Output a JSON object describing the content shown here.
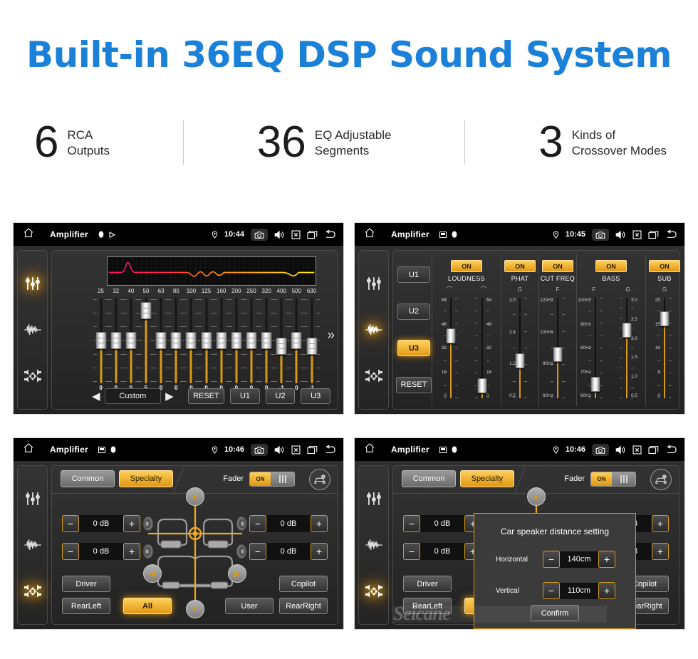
{
  "headline": "Built-in 36EQ DSP Sound System",
  "accent_blue": "#1a80d8",
  "accent_amber": "#e09612",
  "stats": [
    {
      "number": "6",
      "text": "RCA\nOutputs"
    },
    {
      "number": "36",
      "text": "EQ Adjustable\nSegments"
    },
    {
      "number": "3",
      "text": "Kinds of\nCrossover Modes"
    }
  ],
  "watermark": "Seicane",
  "panels": {
    "eq": {
      "statusbar": {
        "title": "Amplifier",
        "time": "10:44"
      },
      "frequencies": [
        "25",
        "32",
        "40",
        "50",
        "63",
        "80",
        "100",
        "125",
        "160",
        "200",
        "250",
        "320",
        "400",
        "500",
        "630"
      ],
      "values": [
        "0",
        "0",
        "0",
        "5",
        "0",
        "0",
        "0",
        "0",
        "0",
        "0",
        "0",
        "0",
        "-1",
        "0",
        "-1"
      ],
      "preset": "Custom",
      "reset_label": "RESET",
      "u1": "U1",
      "u2": "U2",
      "u3": "U3",
      "next_label": "»"
    },
    "crossover": {
      "statusbar": {
        "title": "Amplifier",
        "time": "10:45"
      },
      "user_buttons": [
        "U1",
        "U2",
        "U3"
      ],
      "active_user": "U3",
      "reset_label": "RESET",
      "sections": [
        {
          "name": "LOUDNESS",
          "state": "ON",
          "glyphs": [
            "⌒",
            "⌒"
          ],
          "scale_left": [
            "64",
            "48",
            "32",
            "16",
            "0"
          ],
          "scale_right": [
            "64",
            "48",
            "32",
            "16",
            "0"
          ]
        },
        {
          "name": "PHAT",
          "state": "ON",
          "glyphs": [
            "G"
          ],
          "scale_left": [
            "3.0",
            "2.1",
            "1.3",
            "0.5"
          ]
        },
        {
          "name": "CUT FREQ",
          "state": "ON",
          "glyphs": [
            "F"
          ],
          "scale_left": [
            "120Hz",
            "100Hz",
            "80Hz",
            "60Hz"
          ]
        },
        {
          "name": "BASS",
          "state": "ON",
          "glyphs": [
            "F",
            "G"
          ],
          "scale_left": [
            "100Hz",
            "90Hz",
            "80Hz",
            "70Hz",
            "60Hz"
          ],
          "scale_right": [
            "3.0",
            "2.5",
            "2.0",
            "1.5",
            "1.0",
            "0.5"
          ]
        },
        {
          "name": "SUB",
          "state": "ON",
          "glyphs": [
            "G"
          ],
          "scale_left": [
            "20",
            "15",
            "10",
            "5",
            "0"
          ]
        }
      ]
    },
    "fader": {
      "statusbar": {
        "title": "Amplifier",
        "time": "10:46"
      },
      "tab_common": "Common",
      "tab_specialty": "Specialty",
      "fader_label": "Fader",
      "fader_state": "ON",
      "channels": [
        {
          "position": "front-left",
          "value": "0 dB"
        },
        {
          "position": "rear-left",
          "value": "0 dB"
        },
        {
          "position": "front-right",
          "value": "0 dB"
        },
        {
          "position": "rear-right",
          "value": "0 dB"
        }
      ],
      "minus": "−",
      "plus": "+",
      "buttons": {
        "driver": "Driver",
        "rearleft": "RearLeft",
        "all": "All",
        "user": "User",
        "copilot": "Copilot",
        "rearright": "RearRight"
      },
      "active_button": "All"
    },
    "distance": {
      "statusbar": {
        "title": "Amplifier",
        "time": "10:46"
      },
      "dialog": {
        "title": "Car speaker distance setting",
        "horizontal_label": "Horizontal",
        "horizontal_value": "140cm",
        "vertical_label": "Vertical",
        "vertical_value": "110cm",
        "confirm_label": "Confirm",
        "minus": "−",
        "plus": "+"
      }
    }
  }
}
